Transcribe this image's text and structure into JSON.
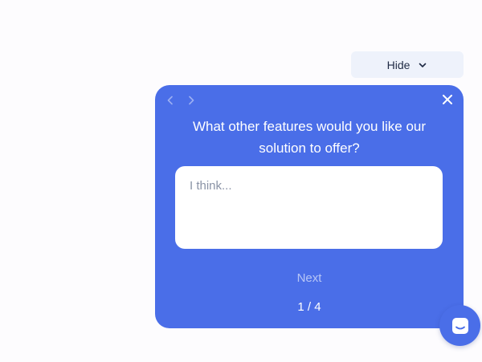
{
  "colors": {
    "accent": "#4a6ee8",
    "hide_button_bg": "#eef2fb"
  },
  "toggle": {
    "hide_label": "Hide",
    "icon": "chevron-down-icon"
  },
  "survey": {
    "question": "What other features would you like our solution to offer?",
    "answer_placeholder": "I think...",
    "answer_value": "",
    "next_label": "Next",
    "pager": "1 / 4",
    "icons": {
      "prev": "chevron-left-icon",
      "next": "chevron-right-icon",
      "close": "close-icon"
    }
  },
  "launcher": {
    "icon": "chat-icon"
  }
}
